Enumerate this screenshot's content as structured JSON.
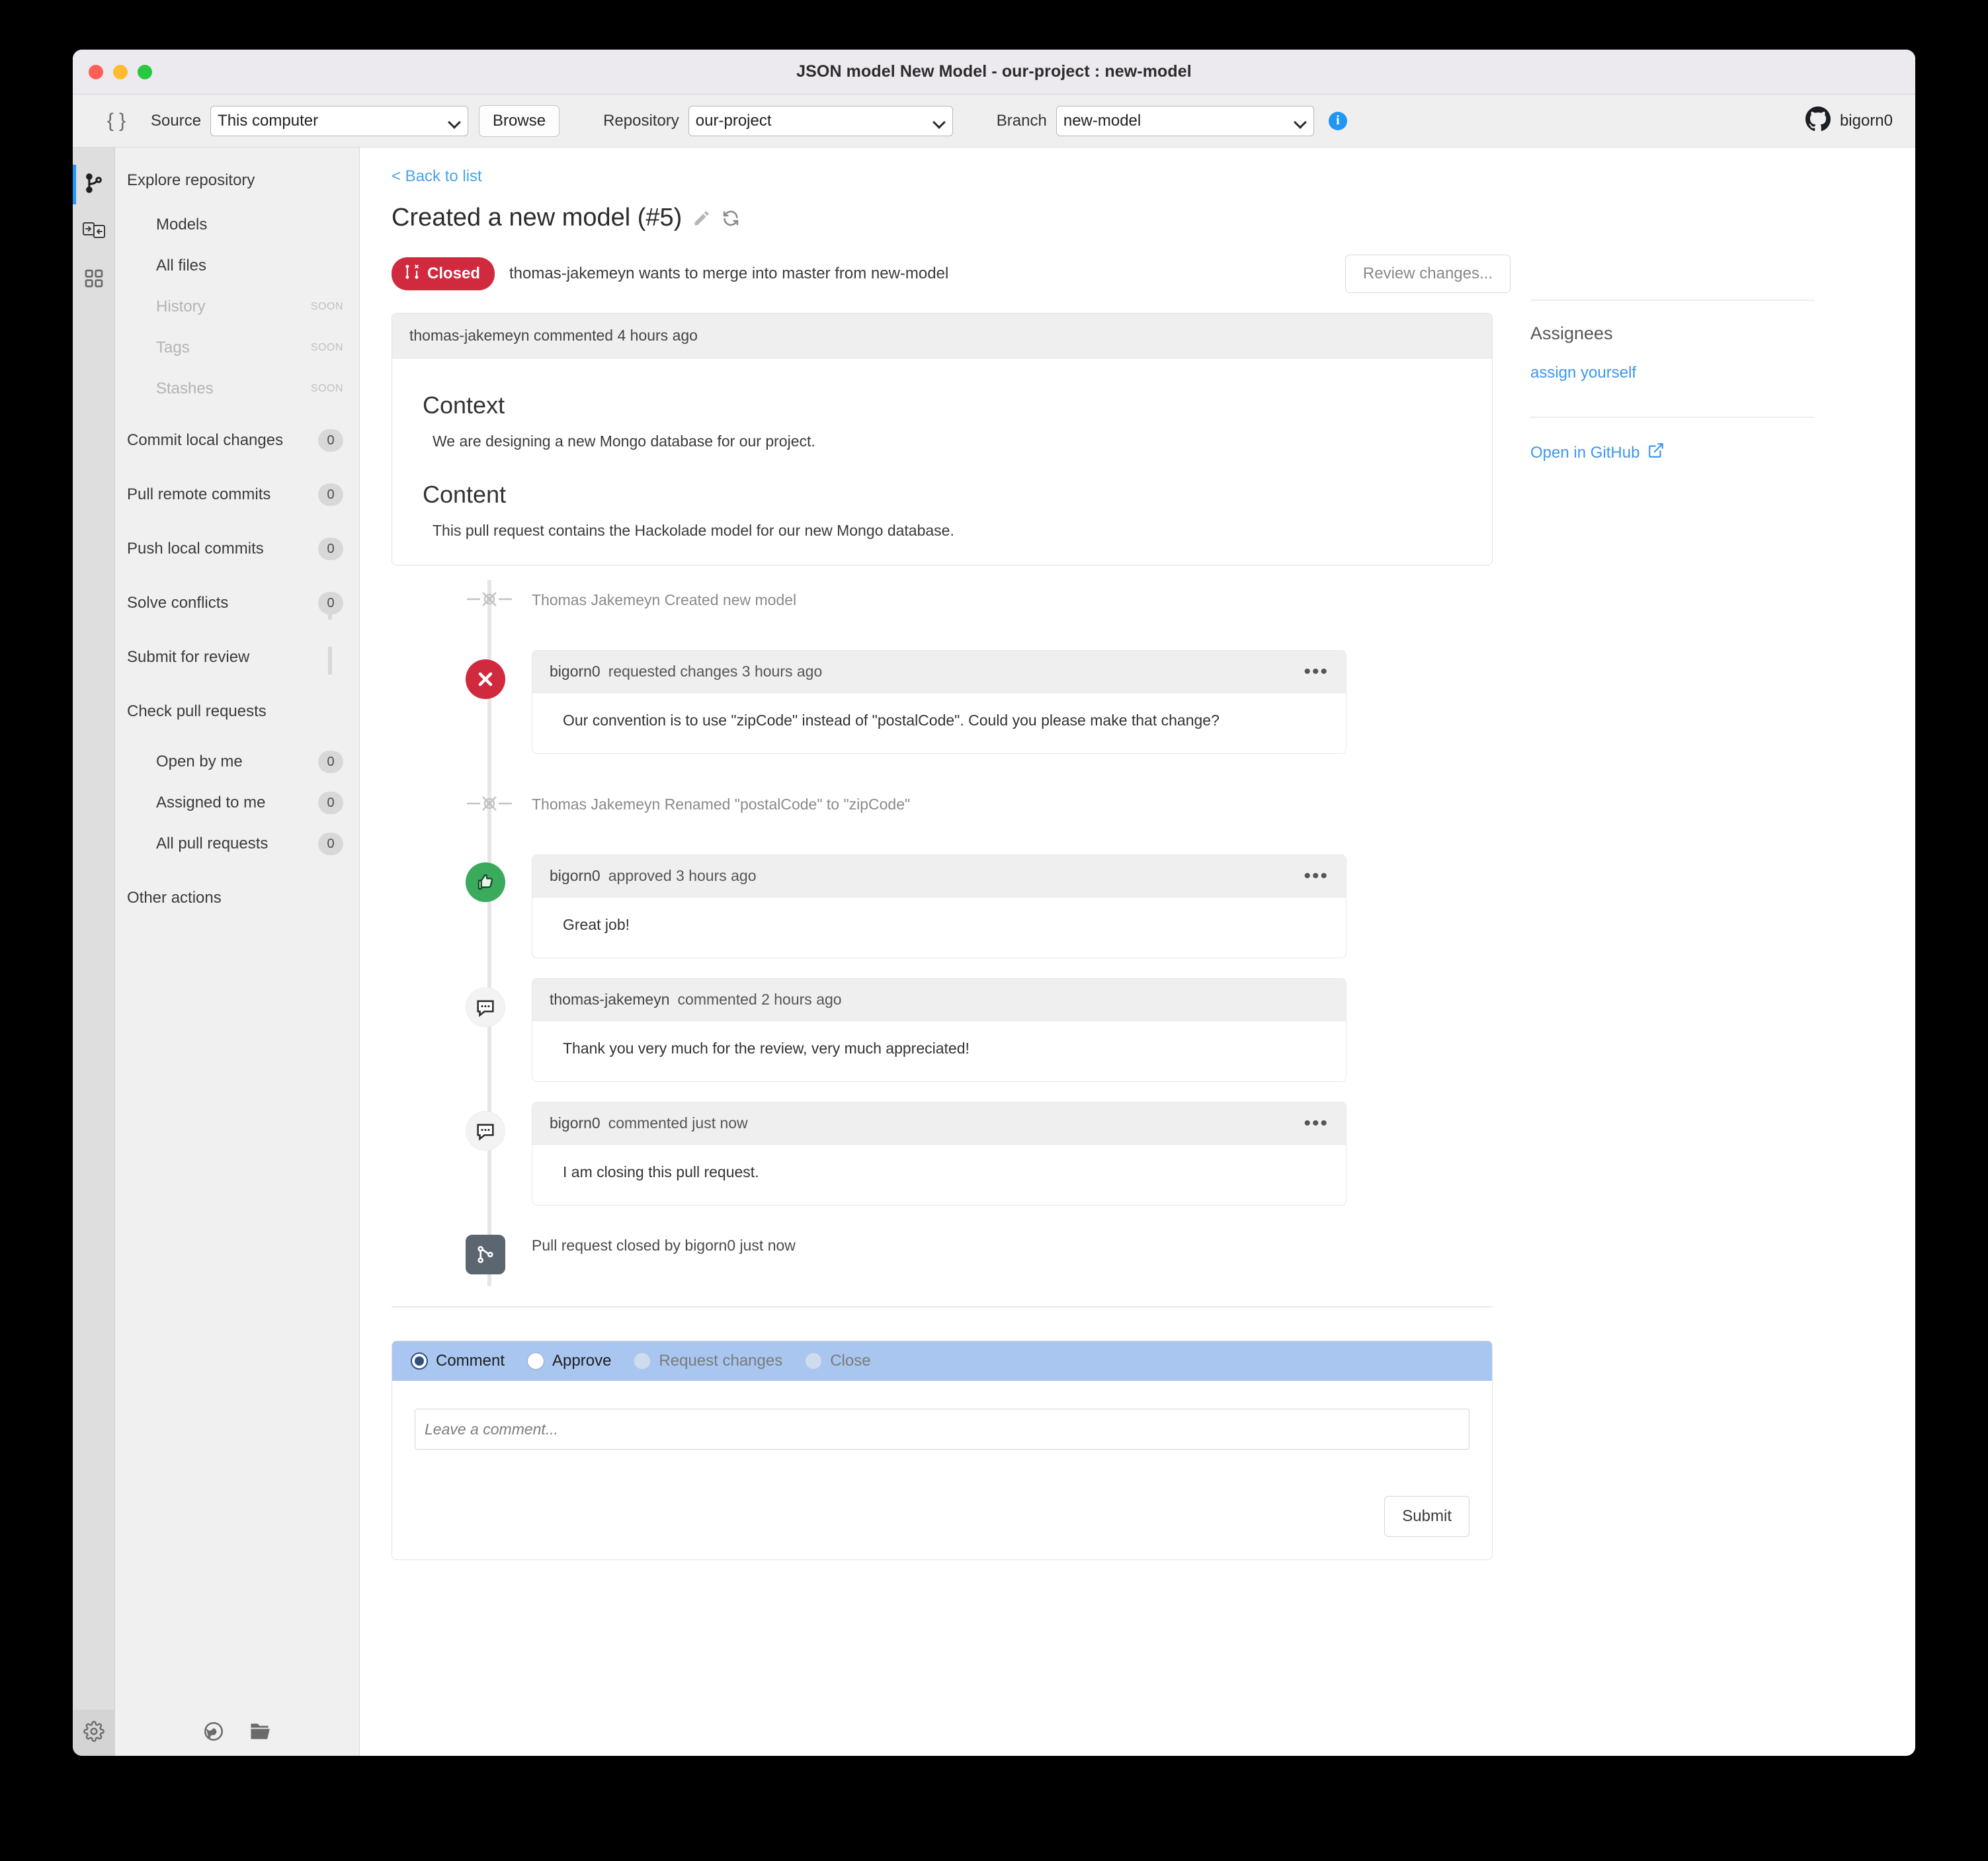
{
  "window": {
    "title": "JSON model New Model - our-project : new-model"
  },
  "toolbar": {
    "json_icon": "braces-icon",
    "source_label": "Source",
    "source_value": "This computer",
    "browse_label": "Browse",
    "repository_label": "Repository",
    "repository_value": "our-project",
    "branch_label": "Branch",
    "branch_value": "new-model",
    "info_icon": "info-icon",
    "github_user": "bigorn0"
  },
  "rail": {
    "items": [
      {
        "icon": "git-branch-icon",
        "active": true
      },
      {
        "icon": "pull-request-compare-icon",
        "active": false
      },
      {
        "icon": "grid-apps-icon",
        "active": false
      }
    ],
    "settings_icon": "gear-icon"
  },
  "nav": {
    "header": "Explore repository",
    "items": [
      {
        "label": "Models",
        "sub": true,
        "badge": null,
        "soon": null
      },
      {
        "label": "All files",
        "sub": true,
        "badge": null,
        "soon": null
      },
      {
        "label": "History",
        "sub": true,
        "badge": null,
        "soon": "SOON"
      },
      {
        "label": "Tags",
        "sub": true,
        "badge": null,
        "soon": "SOON"
      },
      {
        "label": "Stashes",
        "sub": true,
        "badge": null,
        "soon": "SOON"
      },
      {
        "label": "Commit local changes",
        "sub": false,
        "badge": "0",
        "soon": null
      },
      {
        "label": "Pull remote commits",
        "sub": false,
        "badge": "0",
        "soon": null
      },
      {
        "label": "Push local commits",
        "sub": false,
        "badge": "0",
        "soon": null
      },
      {
        "label": "Solve conflicts",
        "sub": false,
        "badge": "0",
        "soon": null
      },
      {
        "label": "Submit for review",
        "sub": false,
        "badge": null,
        "soon": null
      },
      {
        "label": "Check pull requests",
        "sub": false,
        "badge": null,
        "soon": null
      },
      {
        "label": "Open by me",
        "sub": true,
        "badge": "0",
        "soon": null
      },
      {
        "label": "Assigned to me",
        "sub": true,
        "badge": "0",
        "soon": null
      },
      {
        "label": "All pull requests",
        "sub": true,
        "badge": "0",
        "soon": null
      },
      {
        "label": "Other actions",
        "sub": false,
        "badge": null,
        "soon": null
      }
    ],
    "footer_icons": [
      "globe-icon",
      "open-folder-icon"
    ]
  },
  "pr": {
    "back_link": "< Back to list",
    "title": "Created a new model (#5)",
    "edit_icon": "pencil-icon",
    "refresh_icon": "refresh-icon",
    "status_badge": "Closed",
    "status_color": "#d1293d",
    "status_text": "thomas-jakemeyn wants to merge into master from new-model",
    "review_button": "Review changes...",
    "description": {
      "header": "thomas-jakemeyn commented 4 hours ago",
      "heading1": "Context",
      "paragraph1": "We are designing a new Mongo database for our project.",
      "heading2": "Content",
      "paragraph2": "This pull request contains the Hackolade model for our new Mongo database."
    },
    "timeline": [
      {
        "kind": "event",
        "marker": "commit-node-icon",
        "text": "Thomas Jakemeyn Created new model"
      },
      {
        "kind": "comment",
        "marker": "rejected-x-icon",
        "marker_color": "#d1293d",
        "author": "bigorn0",
        "meta": "requested changes 3 hours ago",
        "menu_icon": "ellipsis-icon",
        "body": "Our convention is to use \"zipCode\" instead of \"postalCode\". Could you please make that change?"
      },
      {
        "kind": "event",
        "marker": "commit-node-icon",
        "text": "Thomas Jakemeyn Renamed \"postalCode\" to \"zipCode\""
      },
      {
        "kind": "comment",
        "marker": "thumbs-up-icon",
        "marker_color": "#3aaa5c",
        "author": "bigorn0",
        "meta": "approved 3 hours ago",
        "menu_icon": "ellipsis-icon",
        "body": "Great job!"
      },
      {
        "kind": "comment",
        "marker": "speech-bubble-icon",
        "marker_color": "#f3f3f3",
        "author": "thomas-jakemeyn",
        "meta": "commented 2 hours ago",
        "menu_icon": null,
        "body": "Thank you very much for the review, very much appreciated!"
      },
      {
        "kind": "comment",
        "marker": "speech-bubble-icon",
        "marker_color": "#f3f3f3",
        "author": "bigorn0",
        "meta": "commented just now",
        "menu_icon": "ellipsis-icon",
        "body": "I am closing this pull request."
      },
      {
        "kind": "closed",
        "marker": "pull-request-closed-icon",
        "marker_color": "#5c6670",
        "text": "Pull request closed by bigorn0 just now"
      }
    ],
    "form": {
      "options": [
        {
          "label": "Comment",
          "checked": true,
          "disabled": false
        },
        {
          "label": "Approve",
          "checked": false,
          "disabled": false
        },
        {
          "label": "Request changes",
          "checked": false,
          "disabled": true
        },
        {
          "label": "Close",
          "checked": false,
          "disabled": true
        }
      ],
      "placeholder": "Leave a comment...",
      "value": "",
      "submit_label": "Submit",
      "header_color": "#a9c6f0"
    }
  },
  "side": {
    "assignees_title": "Assignees",
    "assign_link": "assign yourself",
    "open_github_link": "Open in GitHub",
    "external_icon": "external-link-icon"
  }
}
